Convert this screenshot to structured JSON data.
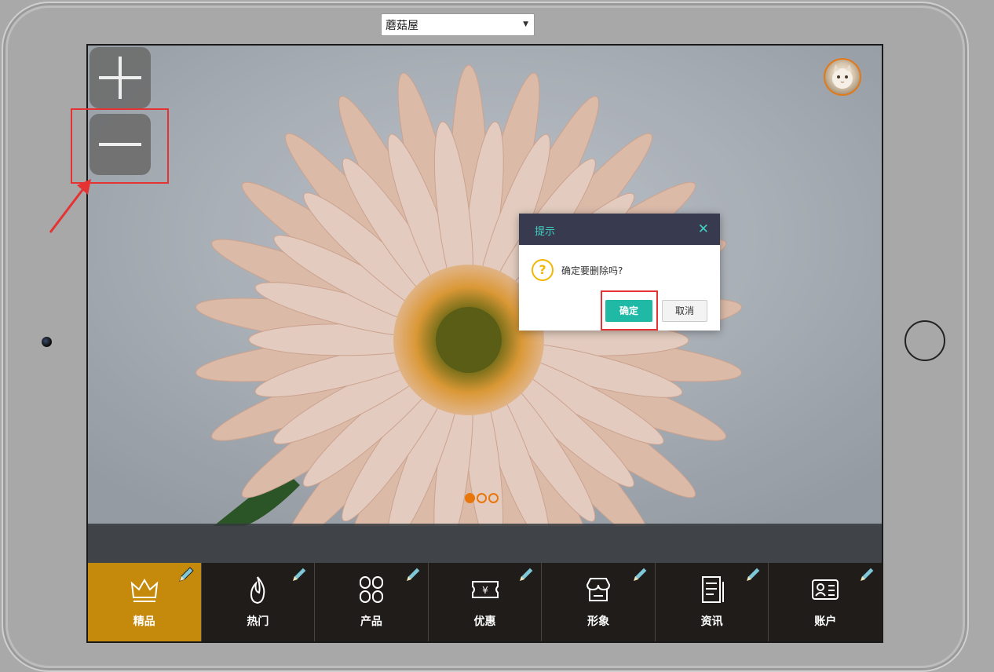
{
  "store_select": {
    "value": "蘑菇屋"
  },
  "zoom": {
    "in_icon": "plus-icon",
    "out_icon": "minus-icon"
  },
  "carousel": {
    "slide_count": 3,
    "active_index": 0,
    "accent": "#e8760a"
  },
  "dialog": {
    "title": "提示",
    "message": "确定要删除吗?",
    "confirm_label": "确定",
    "cancel_label": "取消",
    "close_icon": "close-icon",
    "warning_icon": "?"
  },
  "tabs": [
    {
      "label": "精品",
      "icon": "crown-icon",
      "active": true
    },
    {
      "label": "热门",
      "icon": "flame-icon",
      "active": false
    },
    {
      "label": "产品",
      "icon": "grid-icon",
      "active": false
    },
    {
      "label": "优惠",
      "icon": "coupon-icon",
      "active": false
    },
    {
      "label": "形象",
      "icon": "store-icon",
      "active": false
    },
    {
      "label": "资讯",
      "icon": "news-icon",
      "active": false
    },
    {
      "label": "账户",
      "icon": "id-card-icon",
      "active": false
    }
  ],
  "colors": {
    "tab_active": "#c58a0c",
    "tab_bar": "#1f1c1a",
    "dialog_header": "#383b4f",
    "dialog_accent": "#40d0c0",
    "confirm_button": "#20b9a6",
    "annotation": "#e53333"
  }
}
